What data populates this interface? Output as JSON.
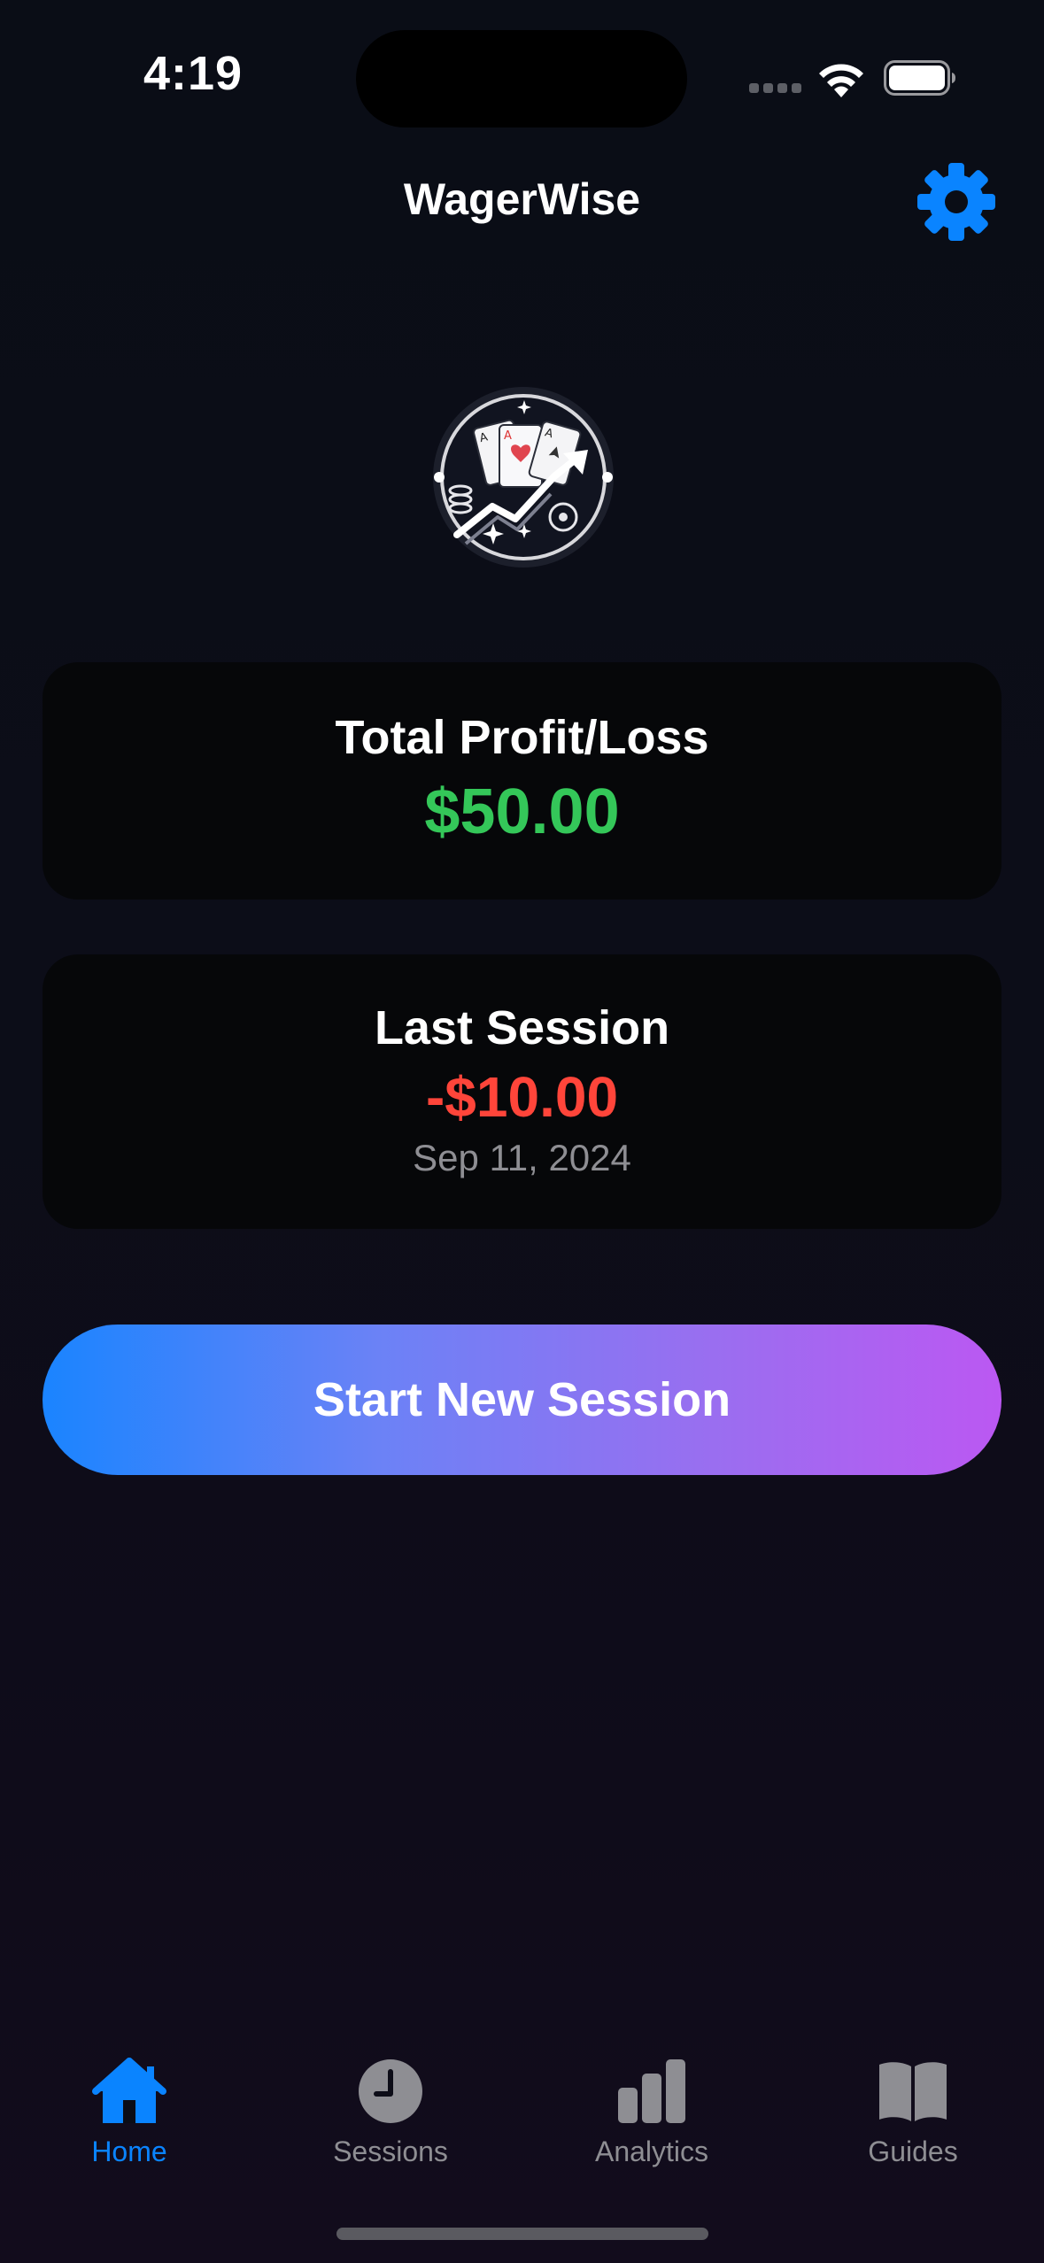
{
  "status_bar": {
    "time": "4:19"
  },
  "header": {
    "title": "WagerWise",
    "settings_icon": "gear-icon"
  },
  "logo": {
    "icon": "cards-chart-logo"
  },
  "total_card": {
    "title": "Total Profit/Loss",
    "value": "$50.00",
    "value_color": "#34c759"
  },
  "last_session_card": {
    "title": "Last Session",
    "value": "-$10.00",
    "value_color": "#ff453a",
    "date": "Sep 11, 2024"
  },
  "start_button": {
    "label": "Start New Session"
  },
  "tab_bar": {
    "tabs": [
      {
        "label": "Home",
        "icon": "house-icon",
        "active": true
      },
      {
        "label": "Sessions",
        "icon": "clock-icon",
        "active": false
      },
      {
        "label": "Analytics",
        "icon": "bar-chart-icon",
        "active": false
      },
      {
        "label": "Guides",
        "icon": "book-icon",
        "active": false
      }
    ]
  },
  "colors": {
    "accent": "#0a84ff",
    "inactive": "#8e8e93",
    "background": "#0b0d16",
    "card": "#060709"
  }
}
